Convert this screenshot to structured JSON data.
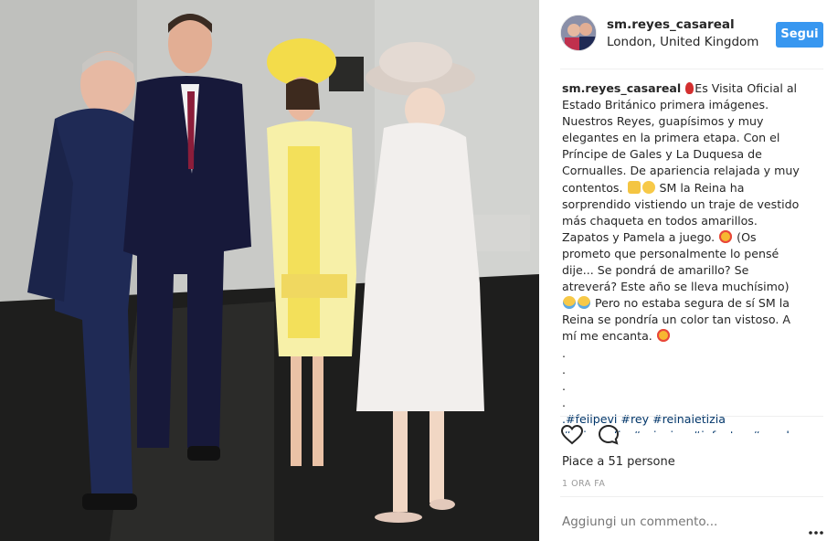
{
  "post": {
    "username": "sm.reyes_casareal",
    "location": "London, United Kingdom",
    "follow_label": "Segui",
    "caption": {
      "username": "sm.reyes_casareal",
      "text_1": "Es Visita Oficial al Estado Británico primera imágenes. Nuestros Reyes, guapísimos y muy elegantes en la primera etapa. Con el Príncipe de Gales y La Duquesa de Cornualles. De apariencia relajada y muy contentos.",
      "text_2": "SM la Reina ha sorprendido vistiendo un traje de vestido más chaqueta en todos amarillos. Zapatos y Pamela a juego.",
      "text_3": "(Os prometo que personalmente lo pensé dije... Se pondrá de amarillo? Se atreverá? Este año se lleva muchísimo)",
      "text_4": "Pero no estaba segura de sí SM la Reina se pondría un color tan vistoso. A mí me encanta.",
      "dots": [
        ".",
        ".",
        ".",
        "."
      ],
      "hashtags": ".#felipevi #rey #reinaletizia",
      "hashtags_more": "#reinasofia #principe #infantas #royal"
    },
    "likes": "Piace a 51 persone",
    "time": "1 ORA FA",
    "comment_placeholder": "Aggiungi un commento..."
  },
  "icons": {
    "like": "heart-outline-icon",
    "comment": "speech-bubble-icon",
    "more": "more-options-icon",
    "pin": "round-pushpin-emoji"
  },
  "colors": {
    "follow_button": "#3897f0",
    "hashtag": "#003569",
    "muted": "#999999"
  }
}
